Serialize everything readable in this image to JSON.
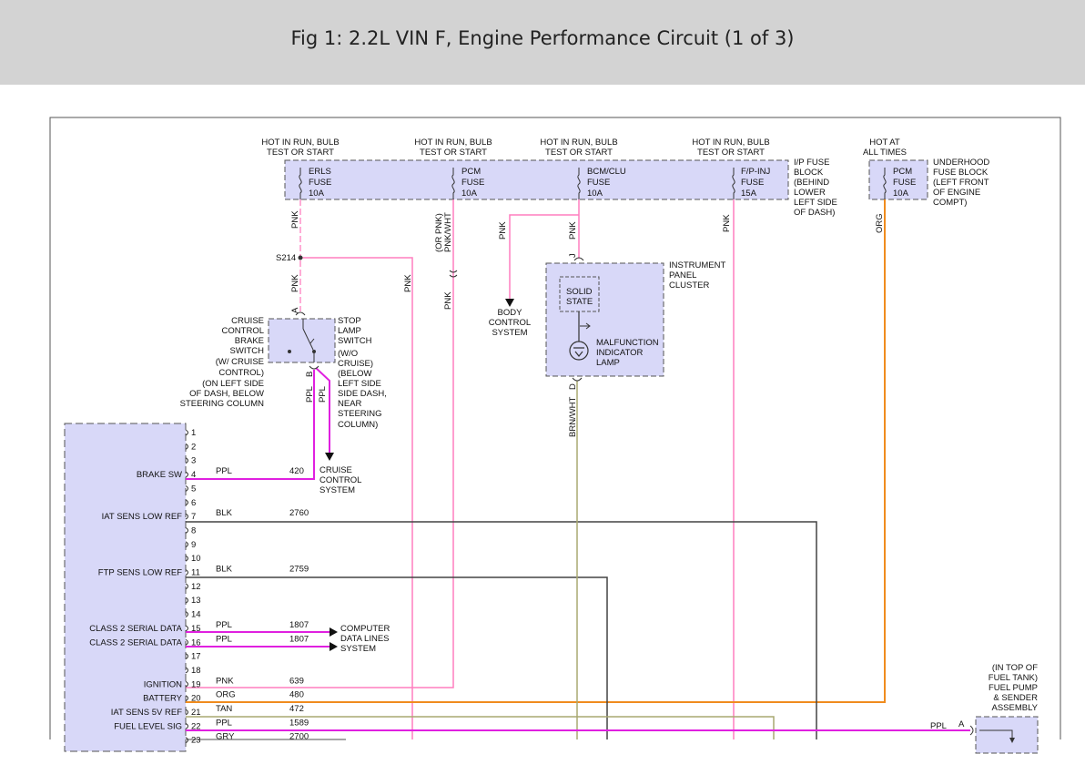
{
  "title": "Fig 1: 2.2L VIN F, Engine Performance Circuit (1 of 3)",
  "power": {
    "hot_run": [
      "HOT IN RUN, BULB",
      "TEST OR START"
    ],
    "hot_always": [
      "HOT AT",
      "ALL TIMES"
    ]
  },
  "fuses": [
    {
      "name": "ERLS",
      "label": "FUSE",
      "rating": "10A"
    },
    {
      "name": "PCM",
      "label": "FUSE",
      "rating": "10A"
    },
    {
      "name": "BCM/CLU",
      "label": "FUSE",
      "rating": "10A"
    },
    {
      "name": "F/P-INJ",
      "label": "FUSE",
      "rating": "15A"
    },
    {
      "name": "PCM",
      "label": "FUSE",
      "rating": "10A"
    }
  ],
  "ip_fuse_block": [
    "I/P FUSE",
    "BLOCK",
    "(BEHIND",
    "LOWER",
    "LEFT SIDE",
    "OF DASH)"
  ],
  "underhood_fuse_block": [
    "UNDERHOOD",
    "FUSE BLOCK",
    "(LEFT FRONT",
    "OF ENGINE",
    "COMPT)"
  ],
  "wire_colors": {
    "pnk": "PNK",
    "pnk_wht": "PNK/WHT",
    "or_pnk": "(OR PNK)",
    "org": "ORG",
    "ppl": "PPL",
    "brn_wht": "BRN/WHT",
    "blk": "BLK",
    "tan": "TAN",
    "gry": "GRY"
  },
  "splice": "S214",
  "brake_switch": {
    "label": [
      "CRUISE",
      "CONTROL",
      "BRAKE",
      "SWITCH",
      "(W/ CRUISE",
      "CONTROL)",
      "(ON LEFT SIDE",
      "OF DASH, BELOW",
      "STEERING COLUMN"
    ],
    "stop_lamp": [
      "STOP",
      "LAMP",
      "SWITCH",
      "(W/O",
      "CRUISE)",
      "(BELOW",
      "LEFT SIDE",
      "SIDE DASH,",
      "NEAR",
      "STEERING",
      "COLUMN)"
    ],
    "pin_a": "A",
    "pin_b": "B"
  },
  "body_control": [
    "BODY",
    "CONTROL",
    "SYSTEM"
  ],
  "cruise_control": [
    "CRUISE",
    "CONTROL",
    "SYSTEM"
  ],
  "computer_data": [
    "COMPUTER",
    "DATA LINES",
    "SYSTEM"
  ],
  "instrument_cluster": {
    "label": [
      "INSTRUMENT",
      "PANEL",
      "CLUSTER"
    ],
    "solid_state": [
      "SOLID",
      "STATE"
    ],
    "mil": [
      "MALFUNCTION",
      "INDICATOR",
      "LAMP"
    ],
    "pin_top": "J",
    "pin_bottom": "D"
  },
  "fuel_tank": {
    "label": [
      "(IN TOP OF",
      "FUEL TANK)",
      "FUEL PUMP",
      "& SENDER",
      "ASSEMBLY"
    ],
    "pin": "A"
  },
  "pcm_pins": [
    {
      "pin": "1",
      "name": "",
      "color": "",
      "circuit": ""
    },
    {
      "pin": "2",
      "name": "",
      "color": "",
      "circuit": ""
    },
    {
      "pin": "3",
      "name": "",
      "color": "",
      "circuit": ""
    },
    {
      "pin": "4",
      "name": "BRAKE SW",
      "color": "PPL",
      "circuit": "420"
    },
    {
      "pin": "5",
      "name": "",
      "color": "",
      "circuit": ""
    },
    {
      "pin": "6",
      "name": "",
      "color": "",
      "circuit": ""
    },
    {
      "pin": "7",
      "name": "IAT SENS LOW REF",
      "color": "BLK",
      "circuit": "2760"
    },
    {
      "pin": "8",
      "name": "",
      "color": "",
      "circuit": ""
    },
    {
      "pin": "9",
      "name": "",
      "color": "",
      "circuit": ""
    },
    {
      "pin": "10",
      "name": "",
      "color": "",
      "circuit": ""
    },
    {
      "pin": "11",
      "name": "FTP SENS LOW REF",
      "color": "BLK",
      "circuit": "2759"
    },
    {
      "pin": "12",
      "name": "",
      "color": "",
      "circuit": ""
    },
    {
      "pin": "13",
      "name": "",
      "color": "",
      "circuit": ""
    },
    {
      "pin": "14",
      "name": "",
      "color": "",
      "circuit": ""
    },
    {
      "pin": "15",
      "name": "CLASS 2 SERIAL DATA",
      "color": "PPL",
      "circuit": "1807"
    },
    {
      "pin": "16",
      "name": "CLASS 2 SERIAL DATA",
      "color": "PPL",
      "circuit": "1807"
    },
    {
      "pin": "17",
      "name": "",
      "color": "",
      "circuit": ""
    },
    {
      "pin": "18",
      "name": "",
      "color": "",
      "circuit": ""
    },
    {
      "pin": "19",
      "name": "IGNITION",
      "color": "PNK",
      "circuit": "639"
    },
    {
      "pin": "20",
      "name": "BATTERY",
      "color": "ORG",
      "circuit": "480"
    },
    {
      "pin": "21",
      "name": "IAT SENS 5V REF",
      "color": "TAN",
      "circuit": "472"
    },
    {
      "pin": "22",
      "name": "FUEL LEVEL SIG",
      "color": "PPL",
      "circuit": "1589"
    },
    {
      "pin": "23",
      "name": "",
      "color": "GRY",
      "circuit": "2700"
    }
  ],
  "colors": {
    "component_fill": "#d8d8f8",
    "pink": "#ff7fbf",
    "magenta": "#e020e0",
    "orange": "#f08c1e",
    "olive": "#a8a870",
    "dark": "#444444",
    "title_bg": "#d3d3d3"
  }
}
